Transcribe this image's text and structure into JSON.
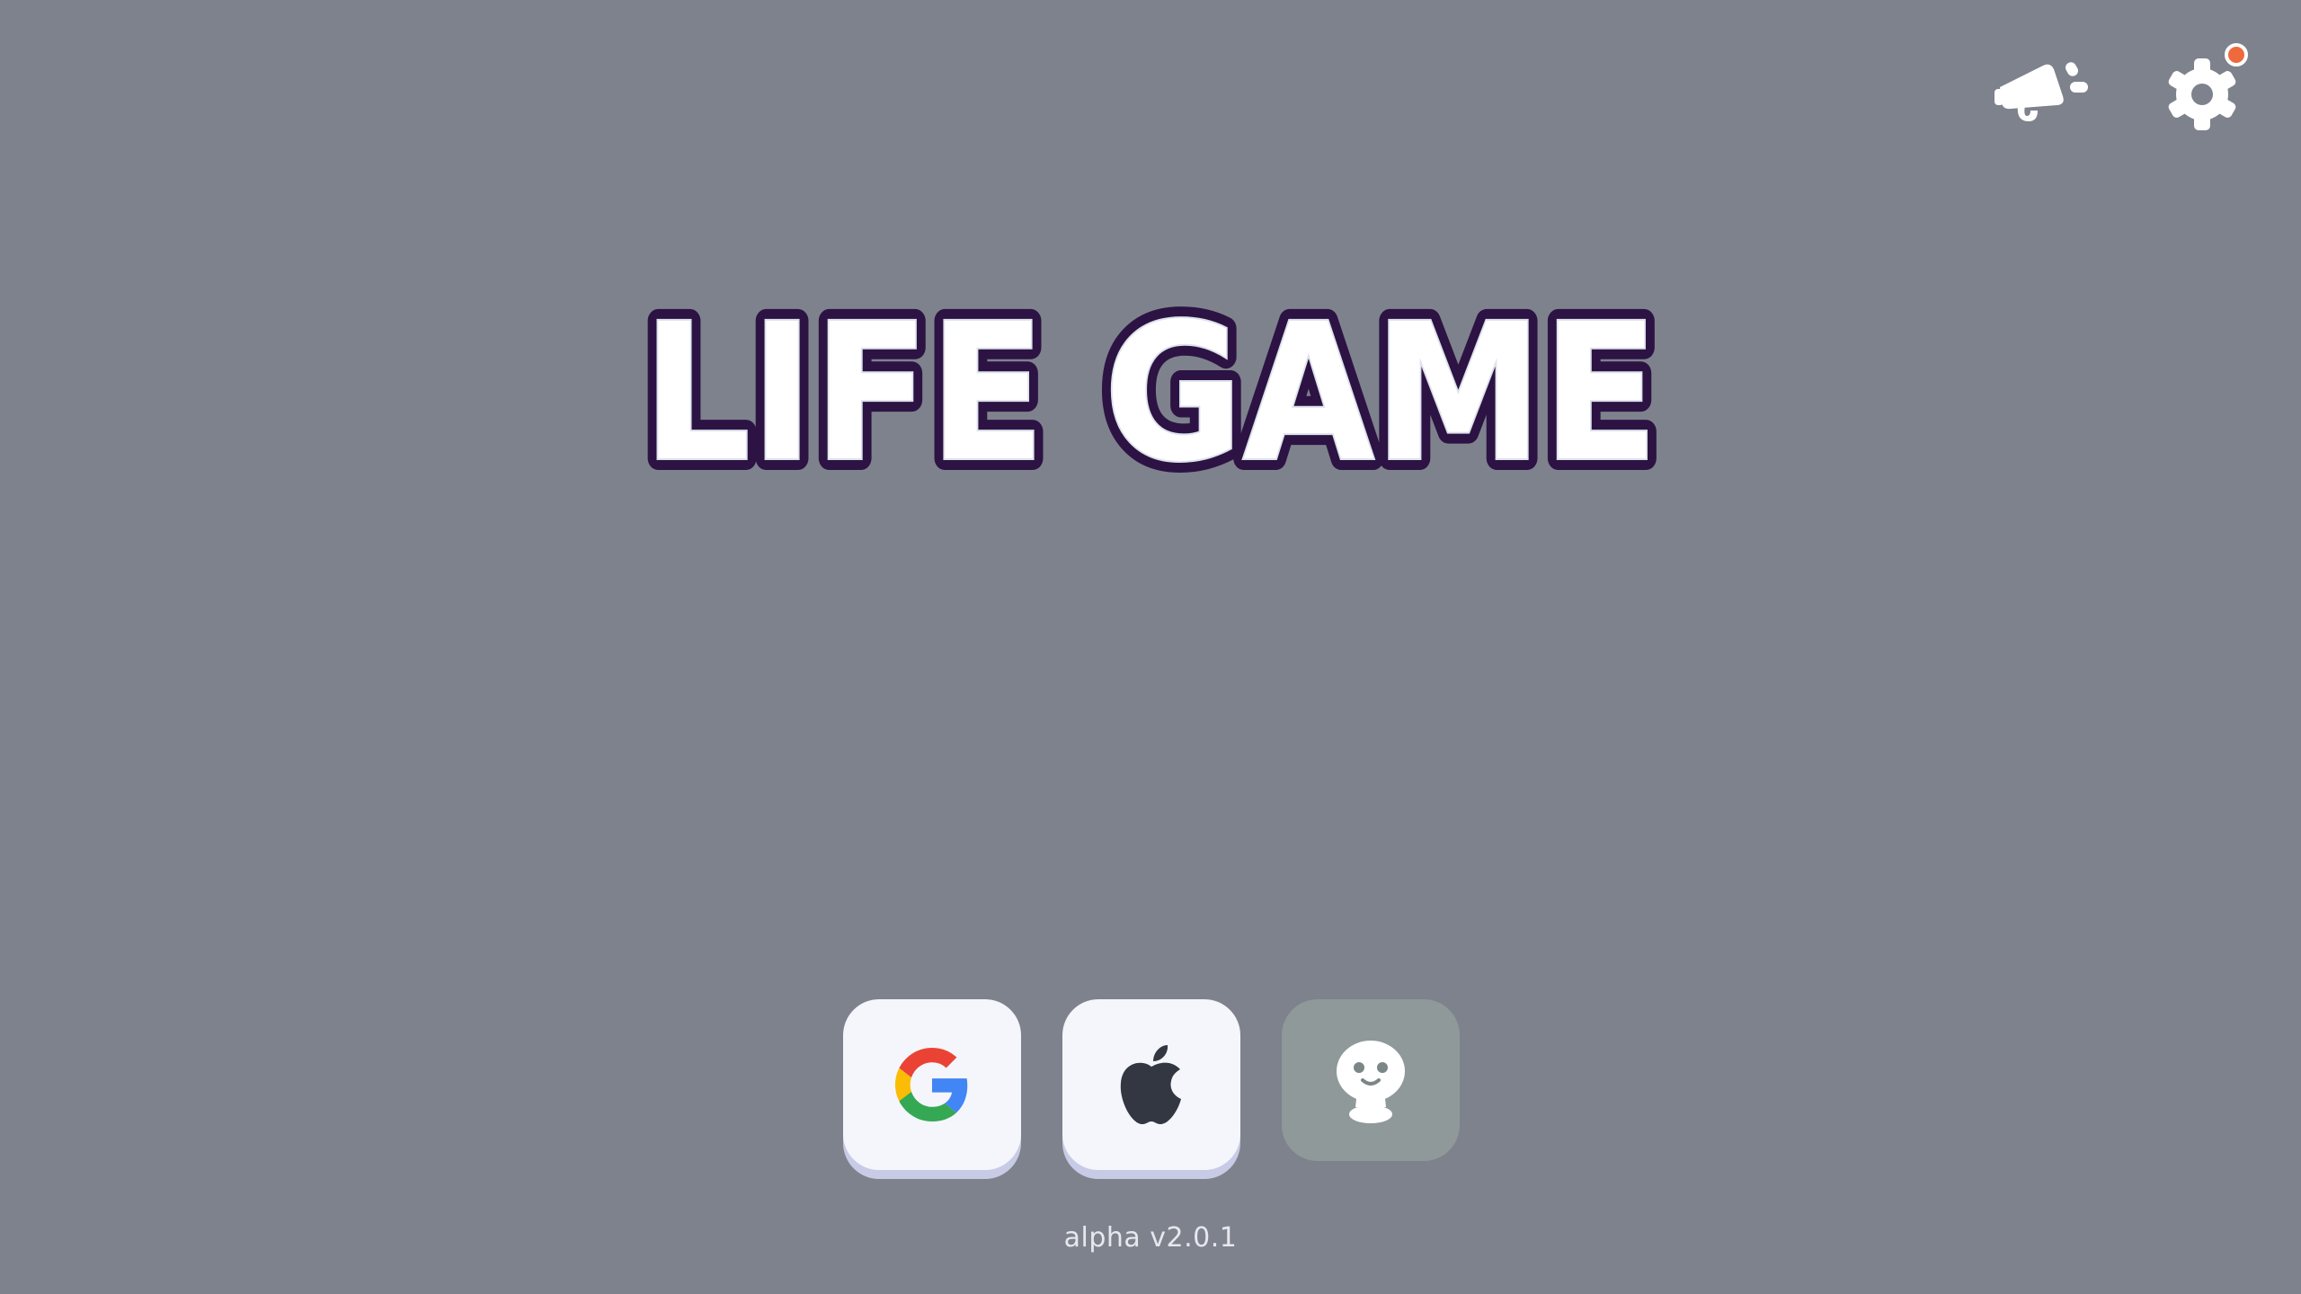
{
  "title": "LIFE GAME",
  "top_bar": {
    "announcements_icon": "megaphone-icon",
    "settings_icon": "gear-icon",
    "settings_has_notification": true
  },
  "login": {
    "buttons": [
      {
        "provider": "Google",
        "icon": "google-icon"
      },
      {
        "provider": "Apple",
        "icon": "apple-icon"
      },
      {
        "provider": "Guest",
        "icon": "guest-icon"
      }
    ]
  },
  "version": "alpha v2.0.1",
  "colors": {
    "background": "#7e828c",
    "title_fill": "#ffffff",
    "title_outline": "#2c1344",
    "button_bg": "#f4f6fb",
    "guest_button_bg": "#8f9999",
    "notification": "#ee6a3c"
  }
}
